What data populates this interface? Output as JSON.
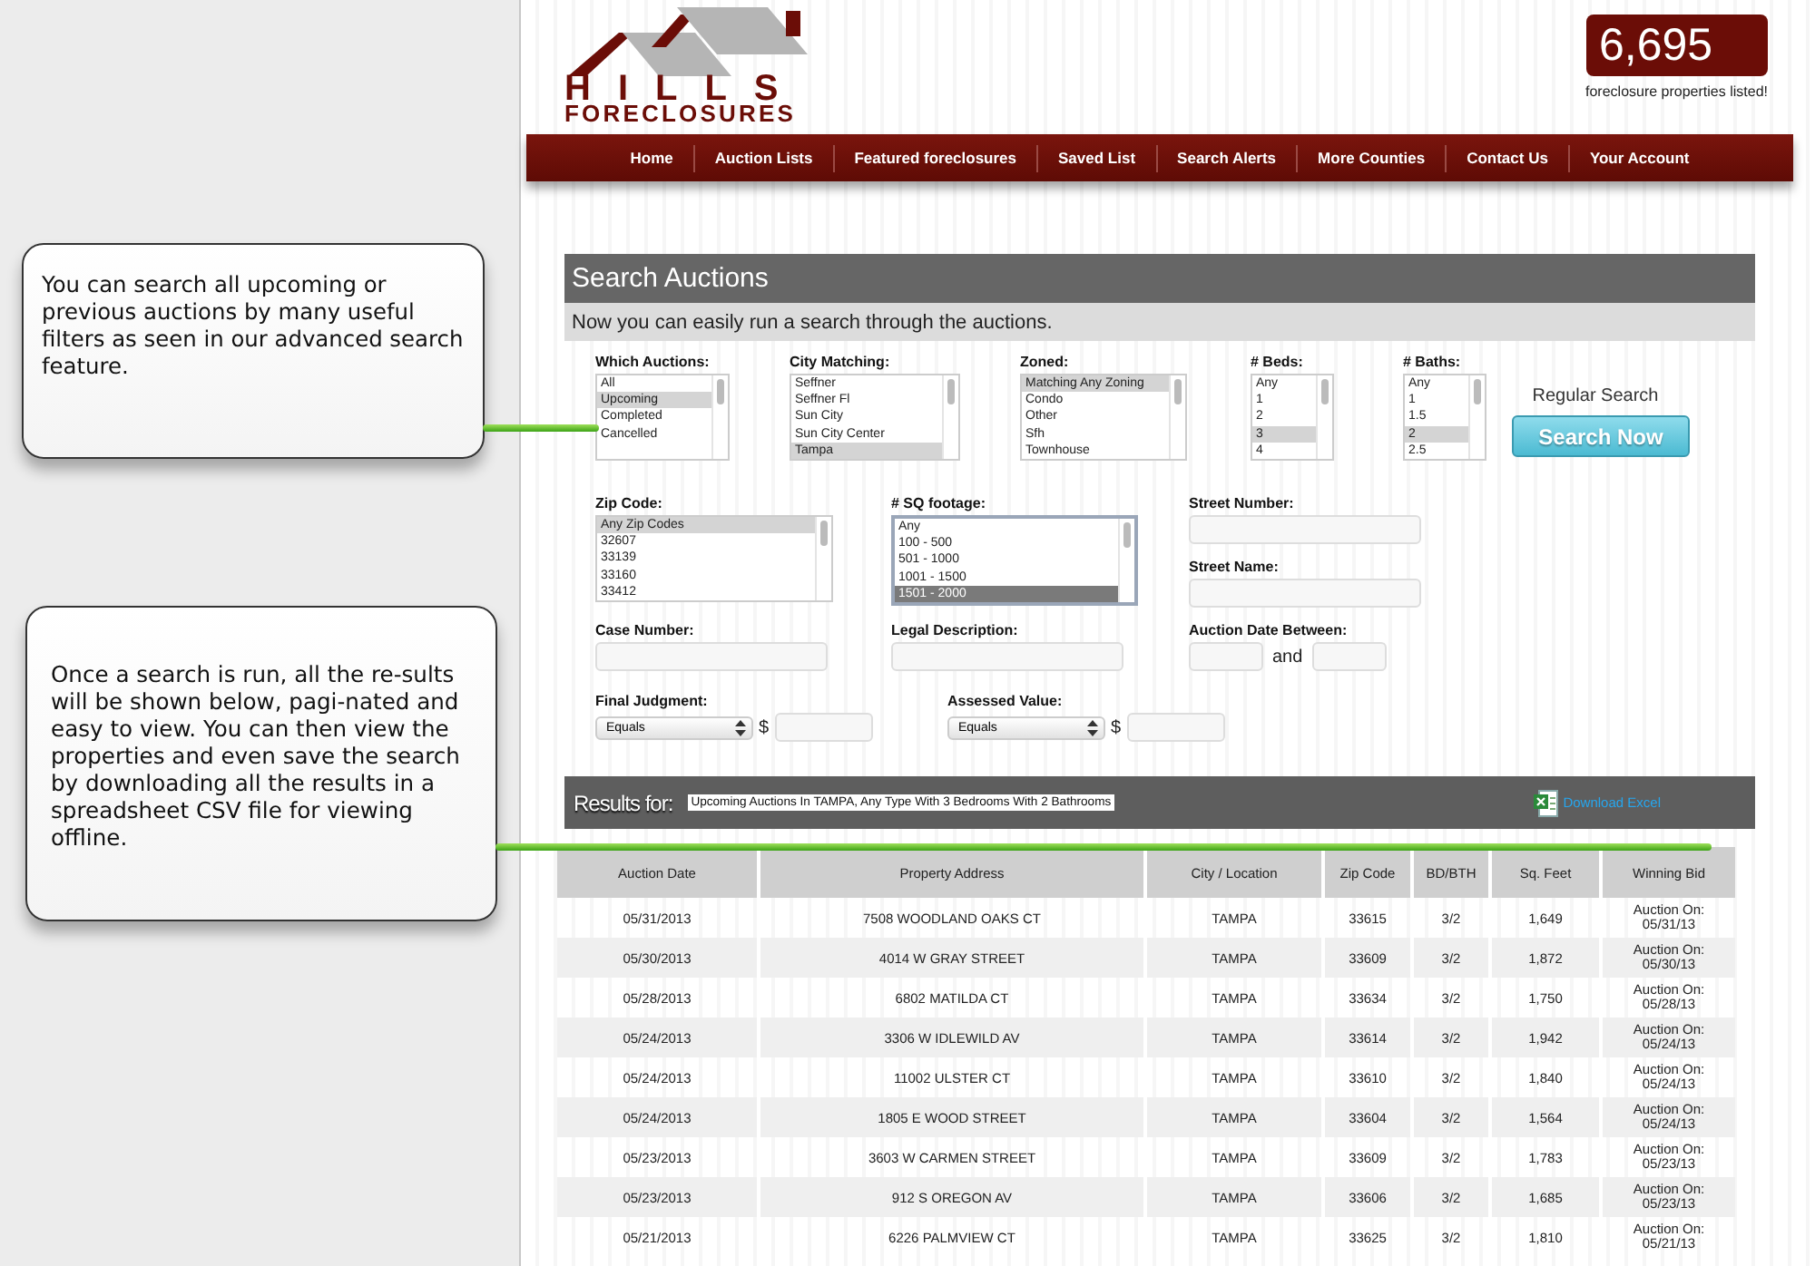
{
  "callouts": [
    {
      "text": "You can search all upcoming or previous auctions by many useful filters as seen in our advanced search feature."
    },
    {
      "text": "Once a search is run, all the re-sults will be shown below, pagi-nated and easy to view.  You can then view the properties and even save the search by downloading all the results in a spreadsheet CSV file for viewing offline."
    }
  ],
  "logo": {
    "line1": "HILLS",
    "line2": "FORECLOSURES"
  },
  "counter": {
    "value": "6,695",
    "caption": "foreclosure properties listed!"
  },
  "nav": [
    {
      "label": "Home"
    },
    {
      "label": "Auction Lists"
    },
    {
      "label": "Featured foreclosures"
    },
    {
      "label": "Saved List"
    },
    {
      "label": "Search Alerts"
    },
    {
      "label": "More Counties"
    },
    {
      "label": "Contact Us"
    },
    {
      "label": "Your Account"
    }
  ],
  "search": {
    "title": "Search Auctions",
    "subtitle": "Now you can easily run a search through the auctions.",
    "lists_row1": [
      {
        "label": "Which Auctions:",
        "focused": false,
        "options": [
          {
            "label": "All",
            "selected": false
          },
          {
            "label": "Upcoming",
            "selected": true
          },
          {
            "label": "Completed",
            "selected": false
          },
          {
            "label": "Cancelled",
            "selected": false
          }
        ]
      },
      {
        "label": "City Matching:",
        "focused": false,
        "options": [
          {
            "label": "Seffner",
            "selected": false
          },
          {
            "label": "Seffner Fl",
            "selected": false
          },
          {
            "label": "Sun City",
            "selected": false
          },
          {
            "label": "Sun City Center",
            "selected": false
          },
          {
            "label": "Tampa",
            "selected": true
          }
        ]
      },
      {
        "label": "Zoned:",
        "focused": false,
        "options": [
          {
            "label": "Matching Any Zoning",
            "selected": true
          },
          {
            "label": "Condo",
            "selected": false
          },
          {
            "label": "Other",
            "selected": false
          },
          {
            "label": "Sfh",
            "selected": false
          },
          {
            "label": "Townhouse",
            "selected": false
          }
        ]
      },
      {
        "label": "# Beds:",
        "focused": false,
        "options": [
          {
            "label": "Any",
            "selected": false
          },
          {
            "label": "1",
            "selected": false
          },
          {
            "label": "2",
            "selected": false
          },
          {
            "label": "3",
            "selected": true
          },
          {
            "label": "4",
            "selected": false
          }
        ]
      },
      {
        "label": "# Baths:",
        "focused": false,
        "options": [
          {
            "label": "Any",
            "selected": false
          },
          {
            "label": "1",
            "selected": false
          },
          {
            "label": "1.5",
            "selected": false
          },
          {
            "label": "2",
            "selected": true
          },
          {
            "label": "2.5",
            "selected": false
          }
        ]
      }
    ],
    "mode_label": "Regular Search",
    "button": "Search Now",
    "lists_row2": [
      {
        "label": "Zip Code:",
        "focused": false,
        "options": [
          {
            "label": "Any Zip Codes",
            "selected": true
          },
          {
            "label": "32607",
            "selected": false
          },
          {
            "label": "33139",
            "selected": false
          },
          {
            "label": "33160",
            "selected": false
          },
          {
            "label": "33412",
            "selected": false
          }
        ]
      },
      {
        "label": "# SQ footage:",
        "focused": true,
        "options": [
          {
            "label": "Any",
            "selected": false
          },
          {
            "label": "100 - 500",
            "selected": false
          },
          {
            "label": "501 - 1000",
            "selected": false
          },
          {
            "label": "1001 - 1500",
            "selected": false
          },
          {
            "label": "1501 - 2000",
            "selected": true
          }
        ]
      }
    ],
    "street_number": {
      "label": "Street Number:"
    },
    "street_name": {
      "label": "Street Name:"
    },
    "case_number": {
      "label": "Case Number:"
    },
    "legal_description": {
      "label": "Legal Description:"
    },
    "auction_date": {
      "label": "Auction Date Between:",
      "joiner": "and"
    },
    "final_judgment": {
      "label": "Final Judgment:",
      "operator": "Equals",
      "currency": "$"
    },
    "assessed_value": {
      "label": "Assessed Value:",
      "operator": "Equals",
      "currency": "$"
    }
  },
  "results": {
    "label": "Results for:",
    "query": "Upcoming Auctions In TAMPA, Any Type With 3 Bedrooms With 2 Bathrooms",
    "download": "Download Excel",
    "columns": [
      "Auction Date",
      "Property Address",
      "City / Location",
      "Zip Code",
      "BD/BTH",
      "Sq. Feet",
      "Winning Bid"
    ],
    "rows": [
      [
        "05/31/2013",
        "7508 WOODLAND OAKS CT",
        "TAMPA",
        "33615",
        "3/2",
        "1,649",
        "Auction On: 05/31/13"
      ],
      [
        "05/30/2013",
        "4014 W GRAY STREET",
        "TAMPA",
        "33609",
        "3/2",
        "1,872",
        "Auction On: 05/30/13"
      ],
      [
        "05/28/2013",
        "6802 MATILDA CT",
        "TAMPA",
        "33634",
        "3/2",
        "1,750",
        "Auction On: 05/28/13"
      ],
      [
        "05/24/2013",
        "3306 W IDLEWILD AV",
        "TAMPA",
        "33614",
        "3/2",
        "1,942",
        "Auction On: 05/24/13"
      ],
      [
        "05/24/2013",
        "11002 ULSTER CT",
        "TAMPA",
        "33610",
        "3/2",
        "1,840",
        "Auction On: 05/24/13"
      ],
      [
        "05/24/2013",
        "1805 E WOOD STREET",
        "TAMPA",
        "33604",
        "3/2",
        "1,564",
        "Auction On: 05/24/13"
      ],
      [
        "05/23/2013",
        "3603 W CARMEN STREET",
        "TAMPA",
        "33609",
        "3/2",
        "1,783",
        "Auction On: 05/23/13"
      ],
      [
        "05/23/2013",
        "912 S OREGON AV",
        "TAMPA",
        "33606",
        "3/2",
        "1,685",
        "Auction On: 05/23/13"
      ],
      [
        "05/21/2013",
        "6226 PALMVIEW CT",
        "TAMPA",
        "33625",
        "3/2",
        "1,810",
        "Auction On: 05/21/13"
      ]
    ]
  }
}
